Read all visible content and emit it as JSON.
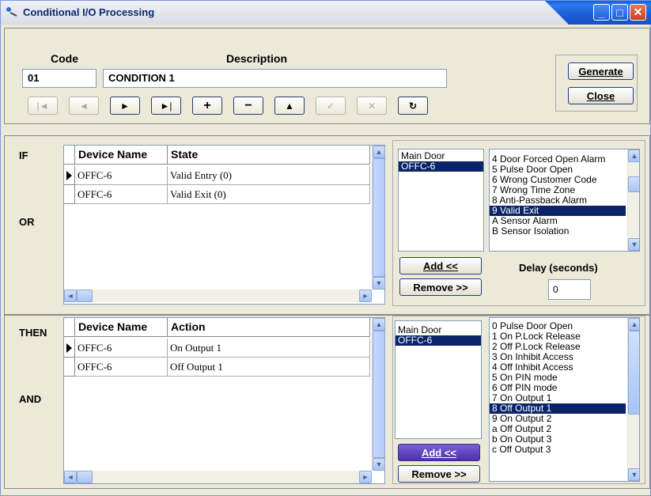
{
  "window": {
    "title": "Conditional I/O Processing"
  },
  "header": {
    "code_label": "Code",
    "description_label": "Description",
    "code_value": "01",
    "description_value": "CONDITION 1",
    "generate_label": "Generate",
    "close_label": "Close"
  },
  "nav": {
    "first": "|◄",
    "prev": "◄",
    "next": "►",
    "last": "►|",
    "add": "+",
    "delete": "−",
    "up": "▲",
    "edit": "✓",
    "cancel": "✕",
    "refresh": "↻"
  },
  "if_section": {
    "if_label": "IF",
    "or_label": "OR",
    "col_device": "Device Name",
    "col_state": "State",
    "rows": [
      {
        "device": "OFFC-6",
        "state": "Valid Entry (0)"
      },
      {
        "device": "OFFC-6",
        "state": "Valid Exit (0)"
      }
    ],
    "doors": [
      "Main Door",
      "OFFC-6"
    ],
    "events": [
      "4 Door Forced Open Alarm",
      "5 Pulse Door Open",
      "6 Wrong Customer Code",
      "7 Wrong Time Zone",
      "8 Anti-Passback Alarm",
      "9 Valid Exit",
      "A Sensor Alarm",
      "B Sensor Isolation"
    ],
    "add_label": "Add <<",
    "remove_label": "Remove >>",
    "delay_label": "Delay (seconds)",
    "delay_value": "0"
  },
  "then_section": {
    "then_label": "THEN",
    "and_label": "AND",
    "col_device": "Device Name",
    "col_action": "Action",
    "rows": [
      {
        "device": "OFFC-6",
        "action": "On Output 1"
      },
      {
        "device": "OFFC-6",
        "action": "Off Output 1"
      }
    ],
    "doors": [
      "Main Door",
      "OFFC-6"
    ],
    "actions": [
      "0 Pulse Door Open",
      "1 On P.Lock Release",
      "2 Off P.Lock Release",
      "3 On Inhibit Access",
      "4 Off Inhibit Access",
      "5 On PIN mode",
      "6 Off PIN mode",
      "7 On Output 1",
      "8 Off Output 1",
      "9 On Output 2",
      "a Off Output 2",
      "b On Output 3",
      "c Off Output 3"
    ],
    "add_label": "Add <<",
    "remove_label": "Remove >>"
  },
  "colors": {
    "selection": "#0a246a",
    "titlebar": "#1d5fd6",
    "face": "#ece9d8"
  }
}
